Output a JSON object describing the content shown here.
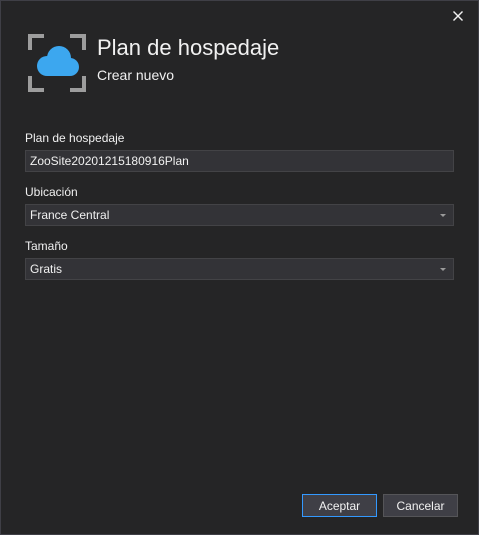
{
  "dialog": {
    "title": "Plan de hospedaje",
    "subtitle": "Crear nuevo",
    "close_icon": "close-icon",
    "header_icon": "cloud-in-frame-icon"
  },
  "form": {
    "plan": {
      "label": "Plan de hospedaje",
      "value": "ZooSite20201215180916Plan"
    },
    "location": {
      "label": "Ubicación",
      "value": "France Central"
    },
    "size": {
      "label": "Tamaño",
      "value": "Gratis"
    }
  },
  "buttons": {
    "accept_label": "Aceptar",
    "cancel_label": "Cancelar"
  },
  "colors": {
    "background": "#252526",
    "input_background": "#333337",
    "accent": "#3399ff",
    "cloud": "#3ca7ef",
    "text": "#f1f1f1"
  }
}
